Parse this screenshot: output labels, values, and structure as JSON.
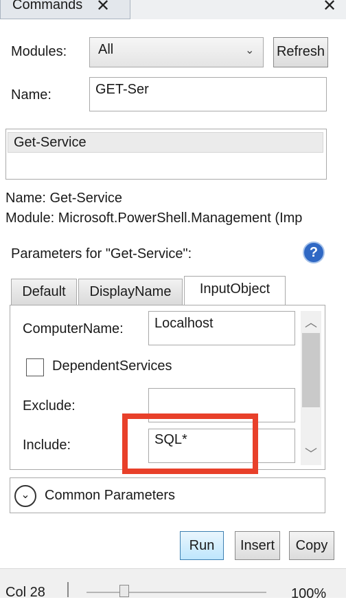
{
  "header": {
    "tab_title": "Commands"
  },
  "modules": {
    "label": "Modules:",
    "value": "All",
    "refresh_label": "Refresh"
  },
  "name_filter": {
    "label": "Name:",
    "value": "GET-Ser"
  },
  "results": {
    "items": [
      "Get-Service"
    ]
  },
  "details": {
    "name_line": "Name: Get-Service",
    "module_line": "Module: Microsoft.PowerShell.Management (Imp"
  },
  "parameters": {
    "title": "Parameters for \"Get-Service\":",
    "tabs": [
      "Default",
      "DisplayName",
      "InputObject"
    ],
    "active_tab": "InputObject",
    "fields": {
      "computer_name": {
        "label": "ComputerName:",
        "value": "Localhost"
      },
      "dependent_services": {
        "label": "DependentServices",
        "checked": false
      },
      "exclude": {
        "label": "Exclude:",
        "value": ""
      },
      "include": {
        "label": "Include:",
        "value": "SQL*"
      }
    }
  },
  "common_parameters": {
    "label": "Common Parameters"
  },
  "actions": {
    "run": "Run",
    "insert": "Insert",
    "copy": "Copy"
  },
  "status": {
    "col": "Col 28",
    "zoom": "100%"
  },
  "colors": {
    "highlight_box": "#e8402a",
    "help_icon": "#2f68c4",
    "accent_button": "#bee6fd"
  },
  "icons": [
    "close-icon",
    "chevron-down-icon",
    "help-icon",
    "expand-circle-icon",
    "scroll-up-icon",
    "scroll-down-icon"
  ]
}
